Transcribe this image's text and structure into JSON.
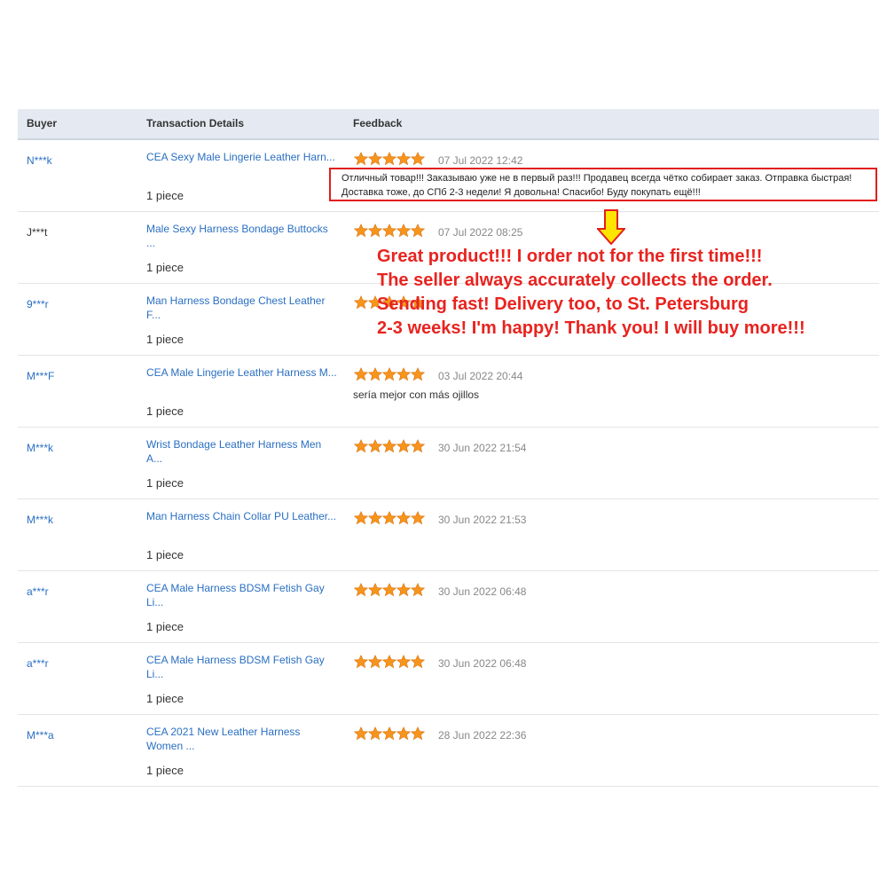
{
  "headers": {
    "buyer": "Buyer",
    "transaction": "Transaction Details",
    "feedback": "Feedback"
  },
  "colors": {
    "link": "#2a6fc2",
    "star": "#f7941d",
    "highlight": "#e21e1e",
    "arrow": "#ffe400"
  },
  "rows": [
    {
      "buyer": "N***k",
      "product": "CEA Sexy Male Lingerie Leather Harn...",
      "qty": "1 piece",
      "stars": 5,
      "date": "07 Jul 2022 12:42",
      "comment": ""
    },
    {
      "buyer": "J***t",
      "product": "Male Sexy Harness Bondage Buttocks ...",
      "qty": "1 piece",
      "stars": 5,
      "date": "07 Jul 2022 08:25",
      "comment": ""
    },
    {
      "buyer": "9***r",
      "product": "Man Harness Bondage Chest Leather F...",
      "qty": "1 piece",
      "stars": 5,
      "date": "",
      "comment": ""
    },
    {
      "buyer": "M***F",
      "product": "CEA Male Lingerie Leather Harness M...",
      "qty": "1 piece",
      "stars": 5,
      "date": "03 Jul 2022 20:44",
      "comment": "sería mejor con más ojillos"
    },
    {
      "buyer": "M***k",
      "product": "Wrist Bondage Leather Harness Men A...",
      "qty": "1 piece",
      "stars": 5,
      "date": "30 Jun 2022 21:54",
      "comment": ""
    },
    {
      "buyer": "M***k",
      "product": "Man Harness Chain Collar PU Leather...",
      "qty": "1 piece",
      "stars": 5,
      "date": "30 Jun 2022 21:53",
      "comment": ""
    },
    {
      "buyer": "a***r",
      "product": "CEA Male Harness BDSM Fetish Gay Li...",
      "qty": "1 piece",
      "stars": 5,
      "date": "30 Jun 2022 06:48",
      "comment": ""
    },
    {
      "buyer": "a***r",
      "product": "CEA Male Harness BDSM Fetish Gay Li...",
      "qty": "1 piece",
      "stars": 5,
      "date": "30 Jun 2022 06:48",
      "comment": ""
    },
    {
      "buyer": "M***a",
      "product": "CEA 2021 New Leather Harness Women ...",
      "qty": "1 piece",
      "stars": 5,
      "date": "28 Jun 2022 22:36",
      "comment": ""
    }
  ],
  "highlight_comment": "Отличный товар!!! Заказываю уже не в первый раз!!! Продавец всегда чётко собирает заказ. Отправка быстрая! Доставка тоже, до СПб 2-3 недели! Я довольна! Спасибо! Буду покупать ещё!!!",
  "translation": [
    "Great product!!! I order not for the first time!!!",
    " The seller always accurately collects the order.",
    " Sending fast! Delivery too, to St. Petersburg",
    " 2-3 weeks! I'm happy! Thank you! I will buy more!!!"
  ]
}
